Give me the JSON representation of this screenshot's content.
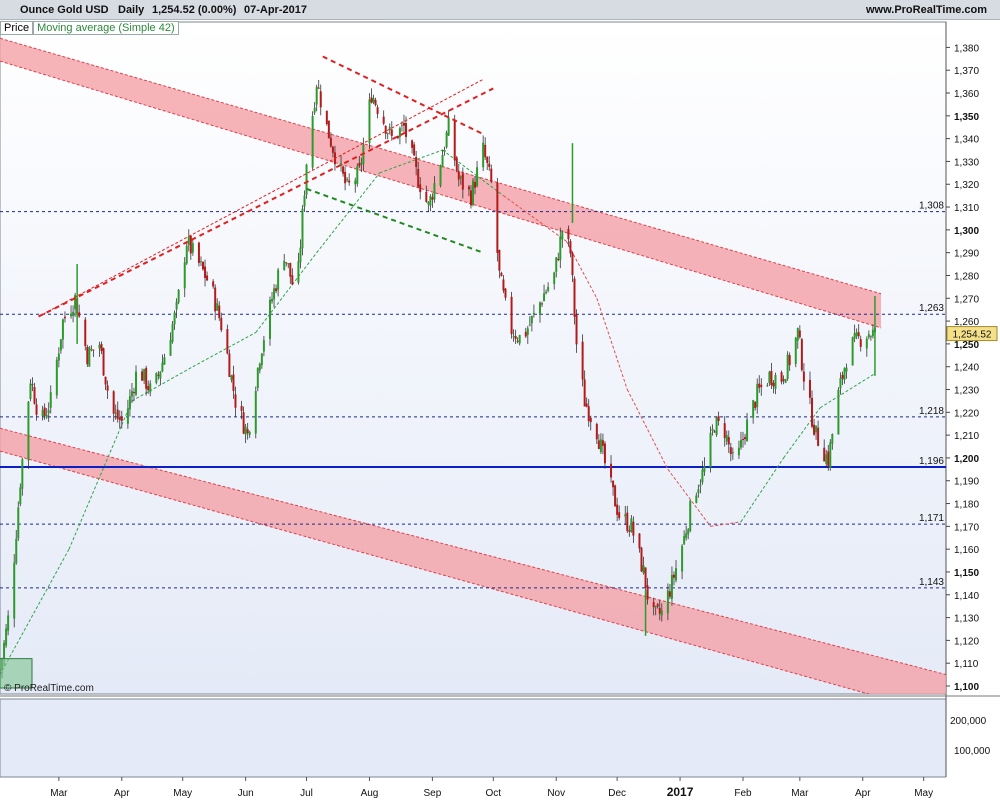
{
  "header": {
    "title": "Ounce Gold USD",
    "interval": "Daily",
    "last": "1,254.52 (0.00%)",
    "date": "07-Apr-2017",
    "site": "www.ProRealTime.com"
  },
  "legend": {
    "price": "Price",
    "ma": "Moving average (Simple 42)"
  },
  "copyright": "© ProRealTime.com",
  "colors": {
    "up": "#2e9a2e",
    "down": "#b51a1a",
    "channel_fill": "#f4a0a6",
    "channel_edge": "#e0404a",
    "support": "#0b1fc8",
    "dashed_level": "#1c2a8c",
    "ma": "#2ea54a",
    "ma_red": "#e05050",
    "bg_top": "#ffffff",
    "bg_bottom": "#e4eaf7",
    "axis_bg": "#ffffff"
  },
  "chart_data": {
    "type": "candlestick",
    "ylim": [
      1100,
      1385
    ],
    "y_ticks": [
      1100,
      1110,
      1120,
      1130,
      1140,
      1150,
      1160,
      1170,
      1180,
      1190,
      1200,
      1210,
      1220,
      1230,
      1240,
      1250,
      1260,
      1270,
      1280,
      1290,
      1300,
      1310,
      1320,
      1330,
      1340,
      1350,
      1360,
      1370,
      1380
    ],
    "y_tick_labels": [
      "1,100",
      "1,110",
      "1,120",
      "1,130",
      "1,140",
      "1,150",
      "1,160",
      "1,170",
      "1,180",
      "1,190",
      "1,200",
      "1,210",
      "1,220",
      "1,230",
      "1,240",
      "1,250",
      "1,260",
      "1,270",
      "1,280",
      "1,290",
      "1,300",
      "1,310",
      "1,320",
      "1,330",
      "1,340",
      "1,350",
      "1,360",
      "1,370",
      "1,380"
    ],
    "y_major": [
      1100,
      1150,
      1200,
      1250,
      1300,
      1350
    ],
    "x_labels": [
      "Mar",
      "Apr",
      "May",
      "Jun",
      "Jul",
      "Aug",
      "Sep",
      "Oct",
      "Nov",
      "Dec",
      "2017",
      "Feb",
      "Mar",
      "Apr",
      "May"
    ],
    "x_label_dates": [
      "2016-03-01",
      "2016-04-01",
      "2016-05-01",
      "2016-06-01",
      "2016-07-01",
      "2016-08-01",
      "2016-09-01",
      "2016-10-01",
      "2016-11-01",
      "2016-12-01",
      "2017-01-01",
      "2017-02-01",
      "2017-03-01",
      "2017-04-01",
      "2017-05-01"
    ],
    "x_range": [
      "2016-02-01",
      "2017-05-12"
    ],
    "levels": [
      {
        "value": 1308,
        "label": "1,308"
      },
      {
        "value": 1263,
        "label": "1,263"
      },
      {
        "value": 1218,
        "label": "1,218"
      },
      {
        "value": 1196,
        "label": "1,196",
        "solid": true
      },
      {
        "value": 1171,
        "label": "1,171"
      },
      {
        "value": 1143,
        "label": "1,143"
      }
    ],
    "last_price_label": "1,254.52",
    "last_price": 1254.52,
    "volume_ticks": [
      "200,000",
      "100,000"
    ],
    "upper_channel": {
      "x": [
        "2016-02-01",
        "2017-04-10"
      ],
      "top": [
        1384,
        1272
      ],
      "bottom": [
        1374,
        1257
      ]
    },
    "lower_channel": {
      "x": [
        "2016-02-01",
        "2017-05-12"
      ],
      "top": [
        1213,
        1105
      ],
      "bottom": [
        1203,
        1087
      ]
    },
    "price_path": [
      [
        "2016-02-01",
        1107
      ],
      [
        "2016-02-06",
        1135
      ],
      [
        "2016-02-11",
        1190
      ],
      [
        "2016-02-16",
        1235
      ],
      [
        "2016-02-21",
        1215
      ],
      [
        "2016-02-26",
        1225
      ],
      [
        "2016-03-03",
        1260
      ],
      [
        "2016-03-09",
        1270
      ],
      [
        "2016-03-15",
        1245
      ],
      [
        "2016-03-21",
        1250
      ],
      [
        "2016-03-27",
        1220
      ],
      [
        "2016-04-02",
        1215
      ],
      [
        "2016-04-09",
        1240
      ],
      [
        "2016-04-16",
        1228
      ],
      [
        "2016-04-22",
        1245
      ],
      [
        "2016-04-28",
        1265
      ],
      [
        "2016-05-03",
        1295
      ],
      [
        "2016-05-09",
        1285
      ],
      [
        "2016-05-15",
        1275
      ],
      [
        "2016-05-21",
        1255
      ],
      [
        "2016-05-27",
        1225
      ],
      [
        "2016-06-02",
        1210
      ],
      [
        "2016-06-08",
        1245
      ],
      [
        "2016-06-14",
        1270
      ],
      [
        "2016-06-20",
        1290
      ],
      [
        "2016-06-26",
        1270
      ],
      [
        "2016-07-01",
        1330
      ],
      [
        "2016-07-06",
        1365
      ],
      [
        "2016-07-11",
        1345
      ],
      [
        "2016-07-16",
        1330
      ],
      [
        "2016-07-21",
        1318
      ],
      [
        "2016-07-27",
        1325
      ],
      [
        "2016-08-02",
        1360
      ],
      [
        "2016-08-07",
        1350
      ],
      [
        "2016-08-12",
        1340
      ],
      [
        "2016-08-18",
        1345
      ],
      [
        "2016-08-24",
        1325
      ],
      [
        "2016-08-30",
        1310
      ],
      [
        "2016-09-05",
        1330
      ],
      [
        "2016-09-09",
        1345
      ],
      [
        "2016-09-14",
        1322
      ],
      [
        "2016-09-20",
        1315
      ],
      [
        "2016-09-26",
        1335
      ],
      [
        "2016-09-30",
        1320
      ],
      [
        "2016-10-04",
        1280
      ],
      [
        "2016-10-09",
        1257
      ],
      [
        "2016-10-15",
        1252
      ],
      [
        "2016-10-21",
        1262
      ],
      [
        "2016-10-26",
        1272
      ],
      [
        "2016-10-31",
        1280
      ],
      [
        "2016-11-04",
        1300
      ],
      [
        "2016-11-08",
        1290
      ],
      [
        "2016-11-11",
        1250
      ],
      [
        "2016-11-15",
        1225
      ],
      [
        "2016-11-21",
        1212
      ],
      [
        "2016-11-27",
        1190
      ],
      [
        "2016-12-02",
        1175
      ],
      [
        "2016-12-08",
        1170
      ],
      [
        "2016-12-14",
        1150
      ],
      [
        "2016-12-18",
        1130
      ],
      [
        "2016-12-23",
        1132
      ],
      [
        "2016-12-28",
        1145
      ],
      [
        "2017-01-03",
        1165
      ],
      [
        "2017-01-08",
        1185
      ],
      [
        "2017-01-13",
        1195
      ],
      [
        "2017-01-18",
        1215
      ],
      [
        "2017-01-23",
        1212
      ],
      [
        "2017-01-28",
        1195
      ],
      [
        "2017-02-02",
        1212
      ],
      [
        "2017-02-08",
        1228
      ],
      [
        "2017-02-14",
        1236
      ],
      [
        "2017-02-20",
        1235
      ],
      [
        "2017-02-25",
        1245
      ],
      [
        "2017-02-28",
        1255
      ],
      [
        "2017-03-04",
        1230
      ],
      [
        "2017-03-09",
        1210
      ],
      [
        "2017-03-15",
        1199
      ],
      [
        "2017-03-20",
        1228
      ],
      [
        "2017-03-25",
        1248
      ],
      [
        "2017-03-30",
        1252
      ],
      [
        "2017-04-04",
        1255
      ],
      [
        "2017-04-07",
        1254.52
      ]
    ],
    "spikes": [
      [
        "2016-03-10",
        1285
      ],
      [
        "2016-11-09",
        1338
      ],
      [
        "2017-04-07",
        1271
      ],
      [
        "2016-12-15",
        1122
      ]
    ],
    "ma42_path": [
      [
        "2016-02-01",
        1105
      ],
      [
        "2016-03-06",
        1160
      ],
      [
        "2016-04-06",
        1225
      ],
      [
        "2016-05-06",
        1240
      ],
      [
        "2016-06-06",
        1255
      ],
      [
        "2016-07-06",
        1290
      ],
      [
        "2016-08-06",
        1325
      ],
      [
        "2016-09-06",
        1335
      ],
      [
        "2016-10-06",
        1315
      ],
      [
        "2016-11-06",
        1295
      ],
      [
        "2016-11-21",
        1270
      ],
      [
        "2016-12-06",
        1230
      ],
      [
        "2016-12-26",
        1195
      ],
      [
        "2017-01-16",
        1170
      ],
      [
        "2017-01-31",
        1172
      ],
      [
        "2017-02-21",
        1200
      ],
      [
        "2017-03-11",
        1222
      ],
      [
        "2017-04-07",
        1237
      ]
    ],
    "ma_red_from": "2016-10-04",
    "ma_red_until": "2017-02-01",
    "trend_lines": [
      {
        "from": [
          "2016-07-09",
          1376
        ],
        "to": [
          "2016-09-26",
          1342
        ],
        "color": "red"
      },
      {
        "from": [
          "2016-07-01",
          1318
        ],
        "to": [
          "2016-09-26",
          1290
        ],
        "color": "green"
      },
      {
        "from": [
          "2016-02-20",
          1262
        ],
        "to": [
          "2016-10-01",
          1362
        ],
        "color": "red"
      },
      {
        "from": [
          "2016-02-20",
          1262
        ],
        "to": [
          "2016-09-26",
          1366
        ],
        "color": "red",
        "thin": true
      }
    ],
    "xlabel": "",
    "ylabel": ""
  }
}
